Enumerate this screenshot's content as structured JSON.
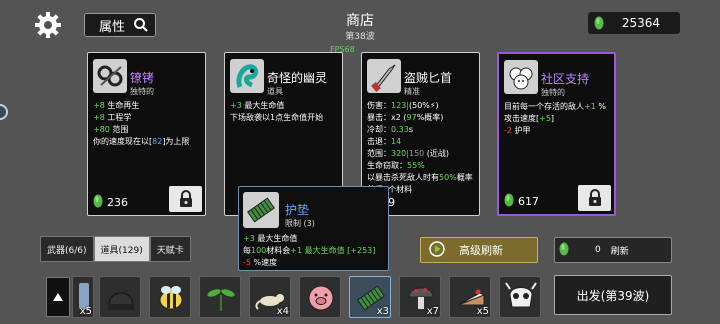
{
  "header": {
    "search_label": "属性",
    "title": "商店",
    "wave": "第38波",
    "fps": "FPS68",
    "money": "25364"
  },
  "cards": [
    {
      "name": "镣铐",
      "rarity": "独特的",
      "lines": [
        {
          "parts": [
            {
              "t": "+8",
              "c": "green"
            },
            {
              "t": " 生命再生",
              "c": ""
            }
          ]
        },
        {
          "parts": [
            {
              "t": "+8",
              "c": "green"
            },
            {
              "t": " 工程学",
              "c": ""
            }
          ]
        },
        {
          "parts": [
            {
              "t": "+80",
              "c": "green"
            },
            {
              "t": " 范围",
              "c": ""
            }
          ]
        },
        {
          "parts": [
            {
              "t": "你的速度现在以[",
              "c": ""
            },
            {
              "t": "82",
              "c": "blue"
            },
            {
              "t": "]为上限",
              "c": ""
            }
          ]
        }
      ],
      "price": "236"
    },
    {
      "name": "奇怪的幽灵",
      "rarity": "道具",
      "lines": [
        {
          "parts": [
            {
              "t": "+3",
              "c": "green"
            },
            {
              "t": " 最大生命值",
              "c": ""
            }
          ]
        },
        {
          "parts": [
            {
              "t": "下场敌袭以1点生命值开始",
              "c": ""
            }
          ]
        }
      ],
      "price": ""
    },
    {
      "name": "盗贼匕首",
      "rarity": "精准",
      "lines": [
        {
          "parts": [
            {
              "t": "伤害：",
              "c": ""
            },
            {
              "t": "123",
              "c": "green"
            },
            {
              "t": "|",
              "c": "gray"
            },
            {
              "t": "(50%",
              "c": ""
            },
            {
              "t": "⚡",
              "c": ""
            },
            {
              "t": ")",
              "c": ""
            }
          ]
        },
        {
          "parts": [
            {
              "t": "暴击：x2 (",
              "c": ""
            },
            {
              "t": "97",
              "c": "green"
            },
            {
              "t": "%概率)",
              "c": ""
            }
          ]
        },
        {
          "parts": [
            {
              "t": "冷却：",
              "c": ""
            },
            {
              "t": "0.33",
              "c": "green"
            },
            {
              "t": "s",
              "c": ""
            }
          ]
        },
        {
          "parts": [
            {
              "t": "击退：",
              "c": ""
            },
            {
              "t": "14",
              "c": "green"
            }
          ]
        },
        {
          "parts": [
            {
              "t": "范围：",
              "c": ""
            },
            {
              "t": "320",
              "c": "green"
            },
            {
              "t": "|",
              "c": "gray"
            },
            {
              "t": "150",
              "c": "gray"
            },
            {
              "t": " (近战)",
              "c": ""
            }
          ]
        },
        {
          "parts": [
            {
              "t": "生命窃取：",
              "c": ""
            },
            {
              "t": "55%",
              "c": "green"
            }
          ]
        },
        {
          "parts": [
            {
              "t": "以暴击杀死敌人时有",
              "c": ""
            },
            {
              "t": "50%",
              "c": "green"
            },
            {
              "t": "概率",
              "c": ""
            }
          ]
        },
        {
          "parts": [
            {
              "t": "获得1个材料",
              "c": ""
            }
          ]
        }
      ],
      "price": "59"
    },
    {
      "name": "社区支持",
      "rarity": "独特的",
      "lines": [
        {
          "parts": [
            {
              "t": "目前每一个存活的敌人",
              "c": ""
            },
            {
              "t": "+1",
              "c": "green"
            },
            {
              "t": " %",
              "c": ""
            }
          ]
        },
        {
          "parts": [
            {
              "t": "攻击速度[",
              "c": ""
            },
            {
              "t": "+5",
              "c": "green"
            },
            {
              "t": "]",
              "c": ""
            }
          ]
        },
        {
          "parts": [
            {
              "t": "-2",
              "c": "red"
            },
            {
              "t": " 护甲",
              "c": ""
            }
          ]
        }
      ],
      "price": "617"
    }
  ],
  "tooltip": {
    "name": "护垫",
    "sub": "限制 (3)",
    "lines": [
      {
        "parts": [
          {
            "t": "+3",
            "c": "green"
          },
          {
            "t": " 最大生命值",
            "c": ""
          }
        ]
      },
      {
        "parts": [
          {
            "t": "每",
            "c": ""
          },
          {
            "t": "100",
            "c": "green"
          },
          {
            "t": "材料会",
            "c": ""
          },
          {
            "t": "+1 最大生命值 [+253]",
            "c": "green"
          }
        ]
      },
      {
        "parts": [
          {
            "t": "-5",
            "c": "red"
          },
          {
            "t": " %速度",
            "c": ""
          }
        ]
      }
    ]
  },
  "tabs": [
    "武器(6/6)",
    "道具(129)",
    "天赋卡"
  ],
  "active_tab": 1,
  "reroll_label": "高级刷新",
  "refresh": {
    "cost": "0",
    "label": "刷新"
  },
  "depart_label": "出发(第39波)",
  "inventory": [
    {
      "icon": "badge-icon",
      "count": "x5"
    },
    {
      "icon": "beanie-icon",
      "count": ""
    },
    {
      "icon": "bee-icon",
      "count": ""
    },
    {
      "icon": "sprout-icon",
      "count": ""
    },
    {
      "icon": "rat-icon",
      "count": "x4"
    },
    {
      "icon": "pig-icon",
      "count": ""
    },
    {
      "icon": "pad-icon",
      "count": "x3"
    },
    {
      "icon": "mushroom-icon",
      "count": "x7"
    },
    {
      "icon": "cake-icon",
      "count": "x5"
    },
    {
      "icon": "skull-icon",
      "count": ""
    }
  ],
  "colors": {
    "green": "#66dd55",
    "red": "#ff4d4d",
    "blue": "#66a5ff",
    "purple": "#9b59d9",
    "gold": "#7c6b2a"
  }
}
